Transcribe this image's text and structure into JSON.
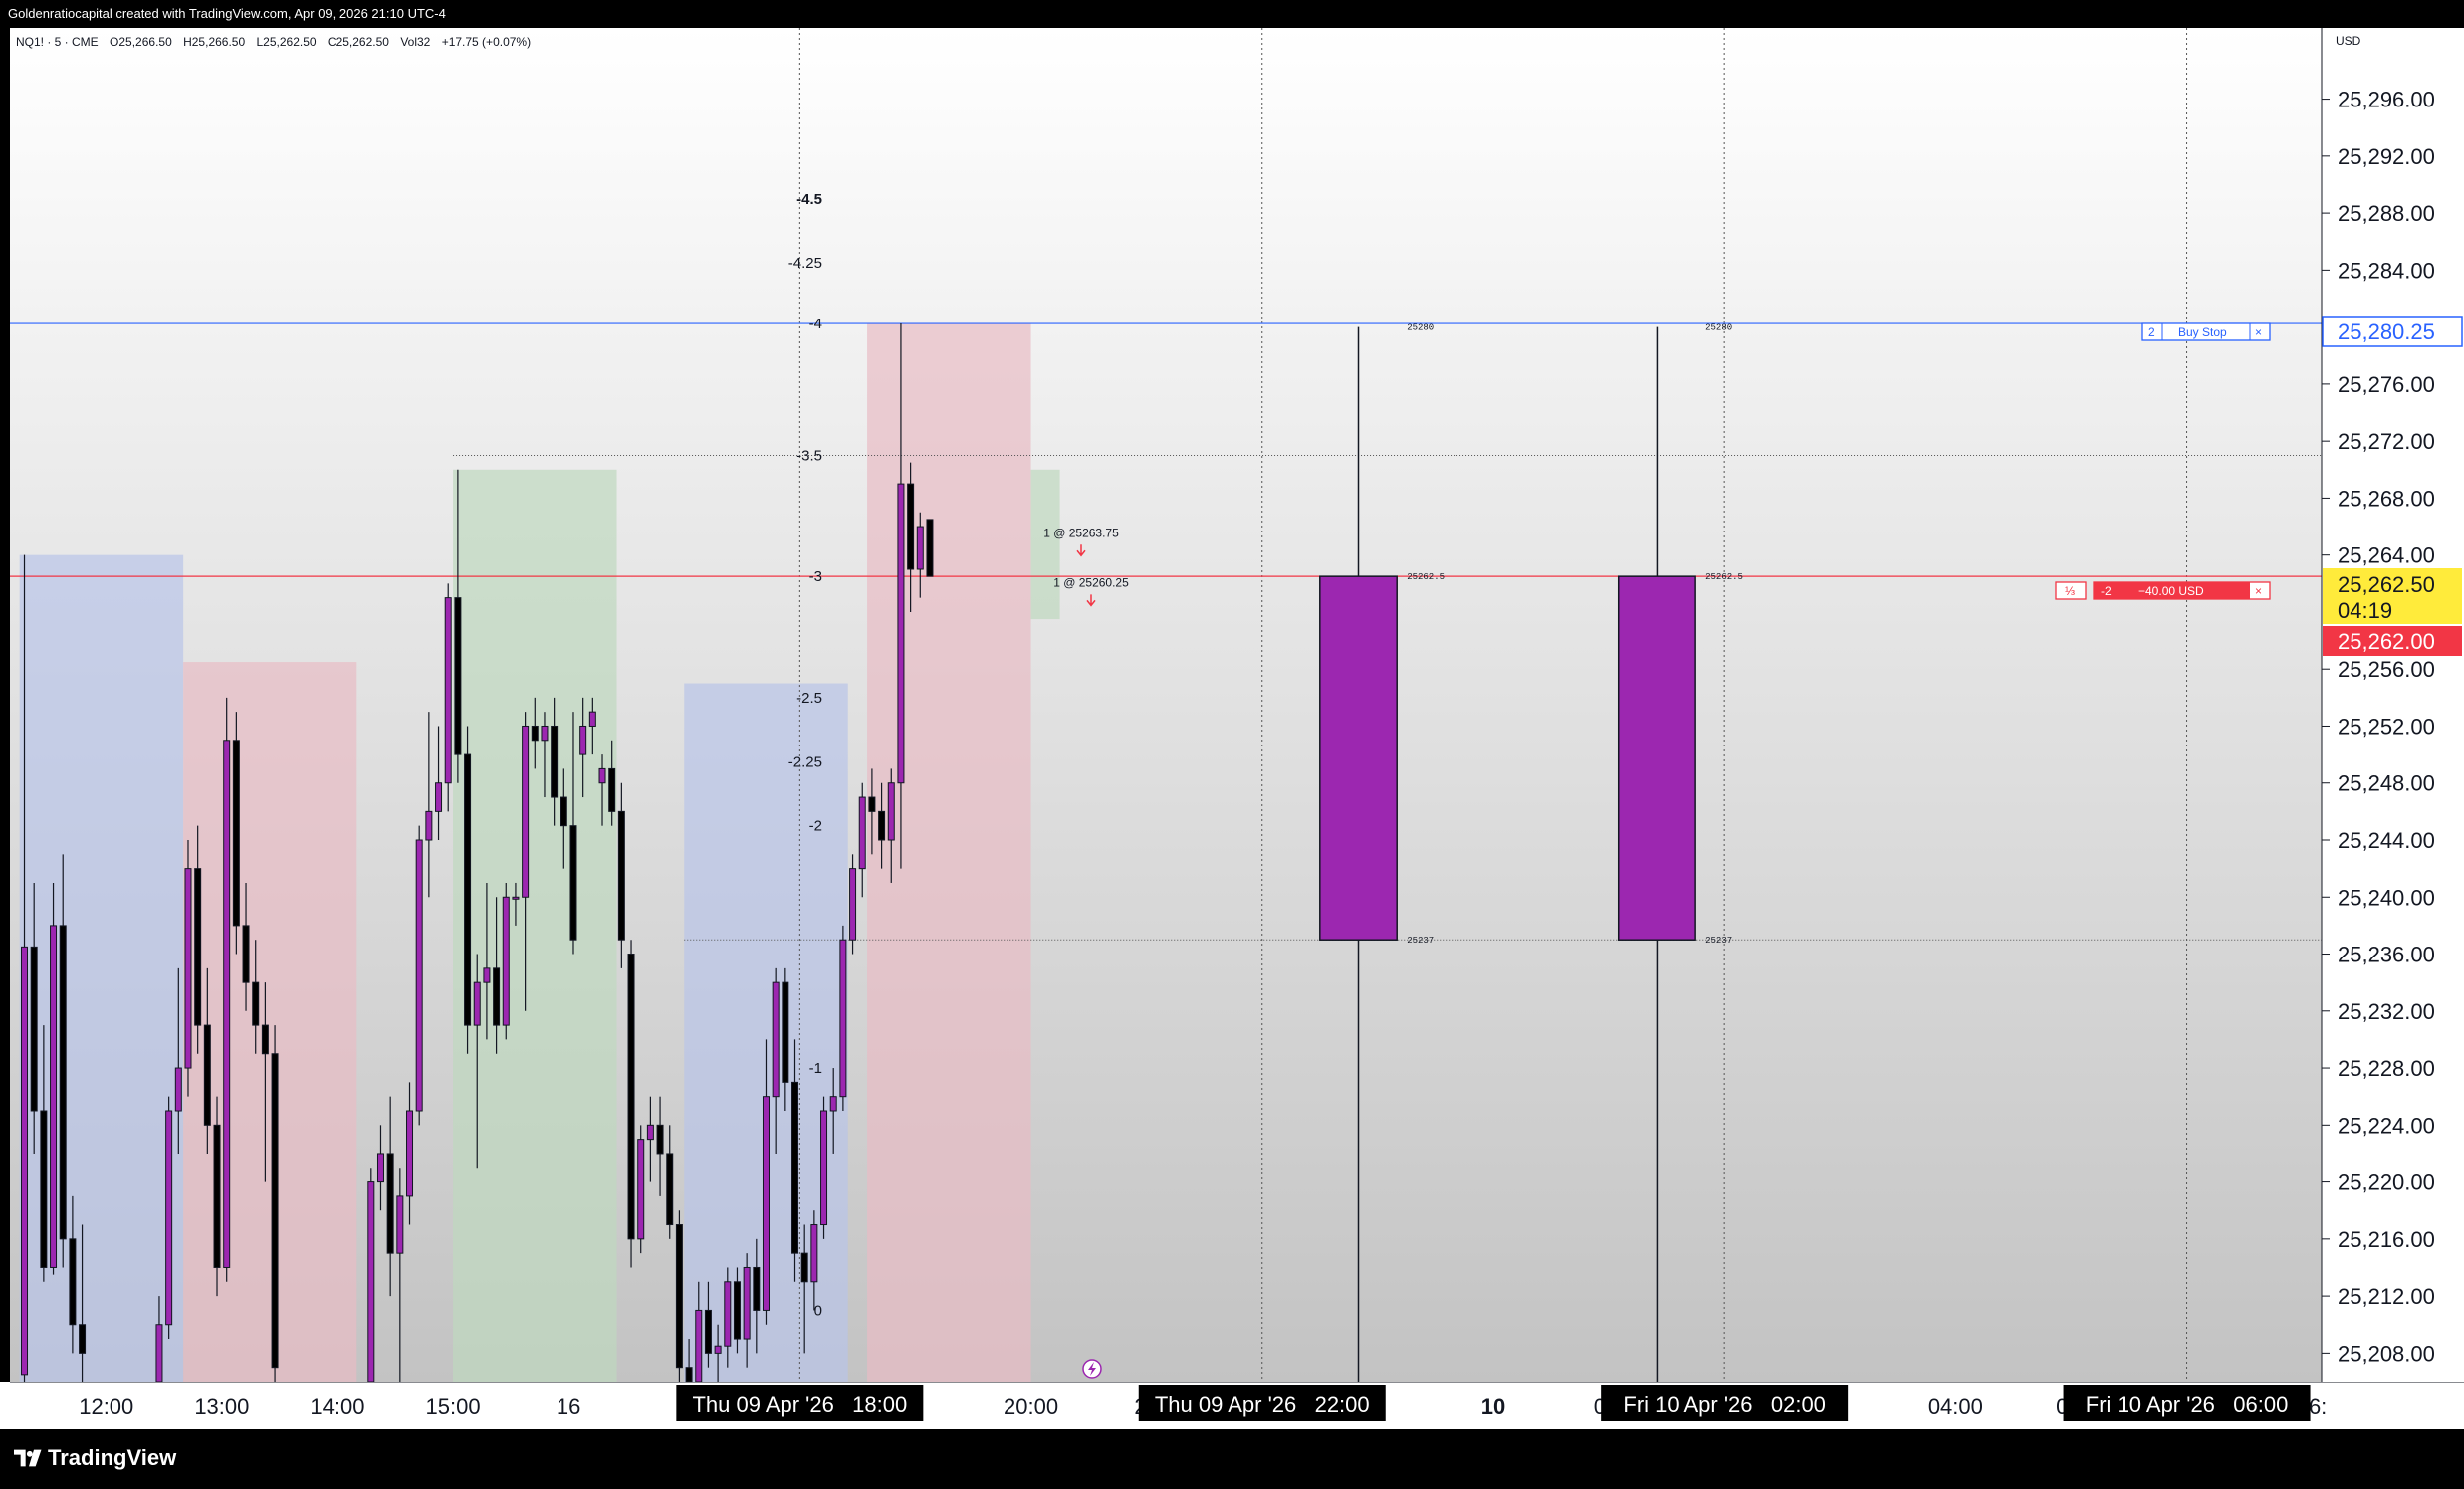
{
  "header": {
    "caption": "Goldenratiocapital created with TradingView.com, Apr 09, 2026 21:10 UTC-4"
  },
  "symbol_bar": {
    "symbol": "NQ1! · 5 · CME",
    "open": "O25,266.50",
    "high": "H25,266.50",
    "low": "L25,262.50",
    "close": "C25,262.50",
    "volume": "Vol32",
    "change": "+17.75 (+0.07%)"
  },
  "currency": "USD",
  "price_scale": {
    "labels": [
      "25,296.00",
      "25,292.00",
      "25,288.00",
      "25,284.00",
      "25,276.00",
      "25,272.00",
      "25,268.00",
      "25,264.00",
      "25,256.00",
      "25,252.00",
      "25,248.00",
      "25,244.00",
      "25,240.00",
      "25,236.00",
      "25,232.00",
      "25,228.00",
      "25,224.00",
      "25,220.00",
      "25,216.00",
      "25,212.00",
      "25,208.00"
    ],
    "buy_stop_price": "25,280.25",
    "last_price": "25,262.50",
    "countdown": "04:19",
    "bid_price": "25,262.00"
  },
  "time_scale": {
    "ticks": [
      "12:00",
      "13:00",
      "14:00",
      "15:00",
      "16",
      "20:00",
      "21",
      "10",
      "01:",
      "04:00",
      "05:",
      "06:"
    ],
    "crosshair_labels": [
      "Thu 09 Apr '26   18:00",
      "Thu 09 Apr '26   22:00",
      "Fri 10 Apr '26   02:00",
      "Fri 10 Apr '26   06:00"
    ],
    "hidden_fragments": [
      ":00",
      ":00",
      ":00"
    ]
  },
  "fib_levels": [
    "-4.5",
    "-4.25",
    "-4",
    "-3.5",
    "-3",
    "-2.5",
    "-2.25",
    "-2",
    "-1",
    "0"
  ],
  "orders": {
    "buy_stop": {
      "qty": "2",
      "label": "Buy Stop",
      "close": "×"
    },
    "position": {
      "tag": "⅓",
      "qty": "-2",
      "pnl": "−40.00 USD",
      "close": "×"
    }
  },
  "executions": [
    "1 @ 25263.75",
    "1 @ 25260.25"
  ],
  "projection_labels": {
    "high": "25280",
    "mid": "25262.5",
    "low": "25237"
  },
  "brand": "TradingView",
  "colors": {
    "bull": "#9c27b0",
    "bear": "#000000",
    "blue_zone": "#b9c4e8",
    "red_zone": "#e8bcc4",
    "green_zone": "#bfd8bf",
    "buy_stop_line": "#2962ff",
    "position_line": "#f23645",
    "last_price_bg": "#ffeb3b"
  },
  "chart_data": {
    "type": "candlestick",
    "interval_minutes": 5,
    "ylim": [
      25206,
      25301
    ],
    "x_range": [
      "2026-04-09 11:10",
      "2026-04-10 07:10"
    ],
    "zones": [
      {
        "kind": "blue",
        "start": "2026-04-09 11:15",
        "end": "2026-04-09 12:40",
        "top": 25264.0,
        "bottom": 25206
      },
      {
        "kind": "red",
        "start": "2026-04-09 12:40",
        "end": "2026-04-09 14:10",
        "top": 25256.5,
        "bottom": 25206
      },
      {
        "kind": "green",
        "start": "2026-04-09 15:00",
        "end": "2026-04-09 16:25",
        "top": 25270.0,
        "bottom": 25206
      },
      {
        "kind": "blue",
        "start": "2026-04-09 17:00",
        "end": "2026-04-09 18:25",
        "top": 25255.0,
        "bottom": 25206
      },
      {
        "kind": "red",
        "start": "2026-04-09 18:35",
        "end": "2026-04-09 20:00",
        "top": 25280.25,
        "bottom": 25206
      },
      {
        "kind": "green",
        "start": "2026-04-09 20:00",
        "end": "2026-04-09 20:15",
        "top": 25270.0,
        "bottom": 25259.5
      }
    ],
    "candles": [
      {
        "t": "2026-04-09 11:15",
        "o": 25206.5,
        "h": 25264.0,
        "l": 25206.0,
        "c": 25236.5
      },
      {
        "t": "2026-04-09 11:20",
        "o": 25236.5,
        "h": 25241.0,
        "l": 25222.0,
        "c": 25225.0
      },
      {
        "t": "2026-04-09 11:25",
        "o": 25225.0,
        "h": 25231.0,
        "l": 25213.0,
        "c": 25214.0
      },
      {
        "t": "2026-04-09 11:30",
        "o": 25214.0,
        "h": 25241.0,
        "l": 25213.5,
        "c": 25238.0
      },
      {
        "t": "2026-04-09 11:35",
        "o": 25238.0,
        "h": 25243.0,
        "l": 25214.0,
        "c": 25216.0
      },
      {
        "t": "2026-04-09 11:40",
        "o": 25216.0,
        "h": 25219.0,
        "l": 25208.0,
        "c": 25210.0
      },
      {
        "t": "2026-04-09 11:45",
        "o": 25210.0,
        "h": 25217.0,
        "l": 25206.0,
        "c": 25208.0
      },
      {
        "t": "2026-04-09 12:25",
        "o": 25206.0,
        "h": 25212.0,
        "l": 25206.0,
        "c": 25210.0
      },
      {
        "t": "2026-04-09 12:30",
        "o": 25210.0,
        "h": 25226.0,
        "l": 25209.0,
        "c": 25225.0
      },
      {
        "t": "2026-04-09 12:35",
        "o": 25225.0,
        "h": 25235.0,
        "l": 25222.0,
        "c": 25228.0
      },
      {
        "t": "2026-04-09 12:40",
        "o": 25228.0,
        "h": 25244.0,
        "l": 25226.0,
        "c": 25242.0
      },
      {
        "t": "2026-04-09 12:45",
        "o": 25242.0,
        "h": 25245.0,
        "l": 25229.0,
        "c": 25231.0
      },
      {
        "t": "2026-04-09 12:50",
        "o": 25231.0,
        "h": 25235.0,
        "l": 25222.0,
        "c": 25224.0
      },
      {
        "t": "2026-04-09 12:55",
        "o": 25224.0,
        "h": 25226.0,
        "l": 25212.0,
        "c": 25214.0
      },
      {
        "t": "2026-04-09 13:00",
        "o": 25214.0,
        "h": 25254.0,
        "l": 25213.0,
        "c": 25251.0
      },
      {
        "t": "2026-04-09 13:05",
        "o": 25251.0,
        "h": 25253.0,
        "l": 25236.0,
        "c": 25238.0
      },
      {
        "t": "2026-04-09 13:10",
        "o": 25238.0,
        "h": 25241.0,
        "l": 25232.0,
        "c": 25234.0
      },
      {
        "t": "2026-04-09 13:15",
        "o": 25234.0,
        "h": 25237.0,
        "l": 25229.0,
        "c": 25231.0
      },
      {
        "t": "2026-04-09 13:20",
        "o": 25231.0,
        "h": 25234.0,
        "l": 25220.0,
        "c": 25229.0
      },
      {
        "t": "2026-04-09 13:25",
        "o": 25229.0,
        "h": 25231.0,
        "l": 25206.0,
        "c": 25207.0
      },
      {
        "t": "2026-04-09 14:15",
        "o": 25206.0,
        "h": 25221.0,
        "l": 25206.0,
        "c": 25220.0
      },
      {
        "t": "2026-04-09 14:20",
        "o": 25220.0,
        "h": 25224.0,
        "l": 25218.0,
        "c": 25222.0
      },
      {
        "t": "2026-04-09 14:25",
        "o": 25222.0,
        "h": 25226.0,
        "l": 25212.0,
        "c": 25215.0
      },
      {
        "t": "2026-04-09 14:30",
        "o": 25215.0,
        "h": 25221.0,
        "l": 25206.0,
        "c": 25219.0
      },
      {
        "t": "2026-04-09 14:35",
        "o": 25219.0,
        "h": 25227.0,
        "l": 25217.0,
        "c": 25225.0
      },
      {
        "t": "2026-04-09 14:40",
        "o": 25225.0,
        "h": 25245.0,
        "l": 25224.0,
        "c": 25244.0
      },
      {
        "t": "2026-04-09 14:45",
        "o": 25244.0,
        "h": 25253.0,
        "l": 25240.0,
        "c": 25246.0
      },
      {
        "t": "2026-04-09 14:50",
        "o": 25246.0,
        "h": 25252.0,
        "l": 25244.0,
        "c": 25248.0
      },
      {
        "t": "2026-04-09 14:55",
        "o": 25248.0,
        "h": 25262.0,
        "l": 25246.0,
        "c": 25261.0
      },
      {
        "t": "2026-04-09 15:00",
        "o": 25261.0,
        "h": 25270.0,
        "l": 25248.0,
        "c": 25250.0
      },
      {
        "t": "2026-04-09 15:05",
        "o": 25250.0,
        "h": 25252.0,
        "l": 25229.0,
        "c": 25231.0
      },
      {
        "t": "2026-04-09 15:10",
        "o": 25231.0,
        "h": 25236.0,
        "l": 25221.0,
        "c": 25234.0
      },
      {
        "t": "2026-04-09 15:15",
        "o": 25234.0,
        "h": 25241.0,
        "l": 25230.0,
        "c": 25235.0
      },
      {
        "t": "2026-04-09 15:20",
        "o": 25235.0,
        "h": 25240.0,
        "l": 25229.0,
        "c": 25231.0
      },
      {
        "t": "2026-04-09 15:25",
        "o": 25231.0,
        "h": 25241.0,
        "l": 25230.0,
        "c": 25240.0
      },
      {
        "t": "2026-04-09 15:30",
        "o": 25240.0,
        "h": 25241.0,
        "l": 25238.0,
        "c": 25240.0
      },
      {
        "t": "2026-04-09 15:35",
        "o": 25240.0,
        "h": 25253.0,
        "l": 25232.0,
        "c": 25252.0
      },
      {
        "t": "2026-04-09 15:40",
        "o": 25252.0,
        "h": 25254.0,
        "l": 25249.0,
        "c": 25251.0
      },
      {
        "t": "2026-04-09 15:45",
        "o": 25251.0,
        "h": 25253.0,
        "l": 25247.0,
        "c": 25252.0
      },
      {
        "t": "2026-04-09 15:50",
        "o": 25252.0,
        "h": 25254.0,
        "l": 25245.0,
        "c": 25247.0
      },
      {
        "t": "2026-04-09 15:55",
        "o": 25247.0,
        "h": 25249.0,
        "l": 25242.0,
        "c": 25245.0
      },
      {
        "t": "2026-04-09 16:00",
        "o": 25245.0,
        "h": 25253.0,
        "l": 25236.0,
        "c": 25237.0
      },
      {
        "t": "2026-04-09 16:05",
        "o": 25250.0,
        "h": 25254.0,
        "l": 25247.0,
        "c": 25252.0
      },
      {
        "t": "2026-04-09 16:10",
        "o": 25252.0,
        "h": 25254.0,
        "l": 25250.0,
        "c": 25253.0
      },
      {
        "t": "2026-04-09 16:15",
        "o": 25248.0,
        "h": 25250.0,
        "l": 25245.0,
        "c": 25249.0
      },
      {
        "t": "2026-04-09 16:20",
        "o": 25249.0,
        "h": 25251.0,
        "l": 25245.0,
        "c": 25246.0
      },
      {
        "t": "2026-04-09 16:25",
        "o": 25246.0,
        "h": 25248.0,
        "l": 25235.0,
        "c": 25237.0
      },
      {
        "t": "2026-04-09 16:30",
        "o": 25236.0,
        "h": 25237.0,
        "l": 25214.0,
        "c": 25216.0
      },
      {
        "t": "2026-04-09 16:35",
        "o": 25216.0,
        "h": 25224.0,
        "l": 25215.0,
        "c": 25223.0
      },
      {
        "t": "2026-04-09 16:40",
        "o": 25223.0,
        "h": 25226.0,
        "l": 25220.0,
        "c": 25224.0
      },
      {
        "t": "2026-04-09 16:45",
        "o": 25224.0,
        "h": 25226.0,
        "l": 25219.0,
        "c": 25222.0
      },
      {
        "t": "2026-04-09 16:50",
        "o": 25222.0,
        "h": 25224.0,
        "l": 25216.0,
        "c": 25217.0
      },
      {
        "t": "2026-04-09 16:55",
        "o": 25217.0,
        "h": 25218.0,
        "l": 25206.0,
        "c": 25207.0
      },
      {
        "t": "2026-04-09 17:00",
        "o": 25207.0,
        "h": 25209.0,
        "l": 25206.0,
        "c": 25206.0
      },
      {
        "t": "2026-04-09 17:05",
        "o": 25206.0,
        "h": 25213.0,
        "l": 25206.0,
        "c": 25211.0
      },
      {
        "t": "2026-04-09 17:10",
        "o": 25211.0,
        "h": 25213.0,
        "l": 25207.0,
        "c": 25208.0
      },
      {
        "t": "2026-04-09 17:15",
        "o": 25208.0,
        "h": 25210.0,
        "l": 25206.0,
        "c": 25208.5
      },
      {
        "t": "2026-04-09 17:20",
        "o": 25208.5,
        "h": 25214.0,
        "l": 25207.0,
        "c": 25213.0
      },
      {
        "t": "2026-04-09 17:25",
        "o": 25213.0,
        "h": 25214.0,
        "l": 25208.0,
        "c": 25209.0
      },
      {
        "t": "2026-04-09 17:30",
        "o": 25209.0,
        "h": 25215.0,
        "l": 25207.0,
        "c": 25214.0
      },
      {
        "t": "2026-04-09 17:35",
        "o": 25214.0,
        "h": 25216.0,
        "l": 25208.0,
        "c": 25211.0
      },
      {
        "t": "2026-04-09 17:40",
        "o": 25211.0,
        "h": 25230.0,
        "l": 25210.0,
        "c": 25226.0
      },
      {
        "t": "2026-04-09 17:45",
        "o": 25226.0,
        "h": 25235.0,
        "l": 25222.0,
        "c": 25234.0
      },
      {
        "t": "2026-04-09 17:50",
        "o": 25234.0,
        "h": 25235.0,
        "l": 25225.0,
        "c": 25227.0
      },
      {
        "t": "2026-04-09 17:55",
        "o": 25227.0,
        "h": 25230.0,
        "l": 25213.0,
        "c": 25215.0
      },
      {
        "t": "2026-04-09 18:00",
        "o": 25215.0,
        "h": 25217.0,
        "l": 25208.0,
        "c": 25213.0
      },
      {
        "t": "2026-04-09 18:05",
        "o": 25213.0,
        "h": 25218.0,
        "l": 25211.0,
        "c": 25217.0
      },
      {
        "t": "2026-04-09 18:10",
        "o": 25217.0,
        "h": 25226.0,
        "l": 25216.0,
        "c": 25225.0
      },
      {
        "t": "2026-04-09 18:15",
        "o": 25225.0,
        "h": 25228.0,
        "l": 25222.0,
        "c": 25226.0
      },
      {
        "t": "2026-04-09 18:20",
        "o": 25226.0,
        "h": 25238.0,
        "l": 25225.0,
        "c": 25237.0
      },
      {
        "t": "2026-04-09 18:25",
        "o": 25237.0,
        "h": 25243.0,
        "l": 25236.0,
        "c": 25242.0
      },
      {
        "t": "2026-04-09 18:30",
        "o": 25242.0,
        "h": 25248.0,
        "l": 25240.0,
        "c": 25247.0
      },
      {
        "t": "2026-04-09 18:35",
        "o": 25247.0,
        "h": 25249.0,
        "l": 25243.0,
        "c": 25246.0
      },
      {
        "t": "2026-04-09 18:40",
        "o": 25246.0,
        "h": 25248.0,
        "l": 25242.0,
        "c": 25244.0
      },
      {
        "t": "2026-04-09 18:45",
        "o": 25244.0,
        "h": 25249.0,
        "l": 25241.0,
        "c": 25248.0
      },
      {
        "t": "2026-04-09 18:50",
        "o": 25248.0,
        "h": 25280.25,
        "l": 25242.0,
        "c": 25269.0
      },
      {
        "t": "2026-04-09 18:55",
        "o": 25269.0,
        "h": 25270.5,
        "l": 25260.0,
        "c": 25263.0
      },
      {
        "t": "2026-04-09 19:00",
        "o": 25263.0,
        "h": 25267.0,
        "l": 25261.0,
        "c": 25266.0
      },
      {
        "t": "2026-04-09 19:05",
        "o": 25266.5,
        "h": 25266.5,
        "l": 25262.5,
        "c": 25262.5
      }
    ],
    "projection_boxes": [
      {
        "start": "2026-04-09 22:30",
        "end": "2026-04-09 23:10",
        "high": 25280,
        "open": 25262.5,
        "low": 25237,
        "bottom": 25206
      },
      {
        "start": "2026-04-10 01:05",
        "end": "2026-04-10 01:45",
        "high": 25280,
        "open": 25262.5,
        "low": 25237,
        "bottom": 25206
      }
    ],
    "buy_stop": 25280.25,
    "position_price": 25262.5,
    "executions_price": [
      25263.75,
      25260.25
    ],
    "fib_prices": [
      25289.0,
      25284.5,
      25280.25,
      25271.0,
      25262.5,
      25254.0,
      25249.5,
      25245.0,
      25228.0,
      25211.0
    ],
    "vertical_markers": [
      "2026-04-09 18:00",
      "2026-04-09 22:00",
      "2026-04-10 02:00",
      "2026-04-10 06:00"
    ],
    "dotted_levels": [
      25271.0,
      25237.0
    ]
  }
}
